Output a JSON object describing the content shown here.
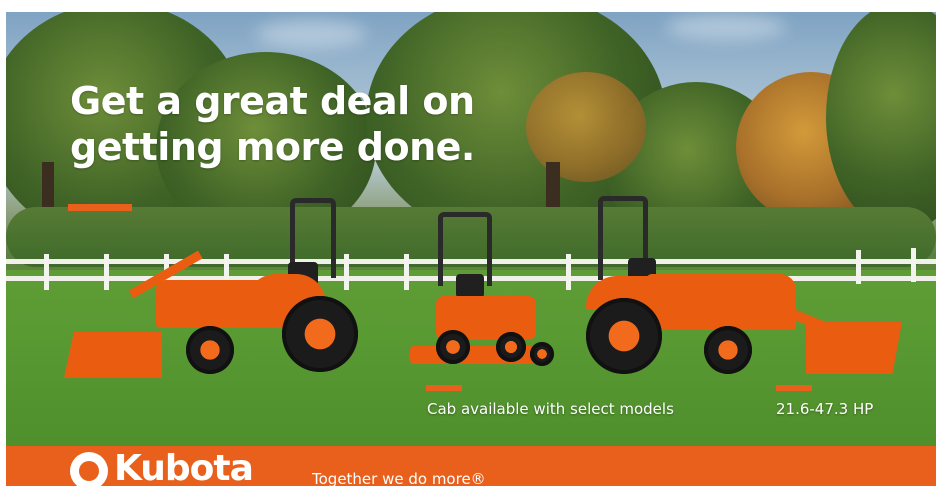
{
  "ad": {
    "headline_line1": "Get a great deal on",
    "headline_line2": "getting more done.",
    "feature_cab": "Cab available with select models",
    "feature_hp": "21.6-47.3 HP"
  },
  "brand": {
    "name": "Kubota",
    "slogan": "Together we do more®"
  },
  "colors": {
    "accent": "#e8601c",
    "tractor_orange": "#ea5d10",
    "grass": "#5a9a33",
    "sky": "#a9c2d4"
  },
  "icons": {
    "brand_mark": "kubota-logo-icon"
  }
}
